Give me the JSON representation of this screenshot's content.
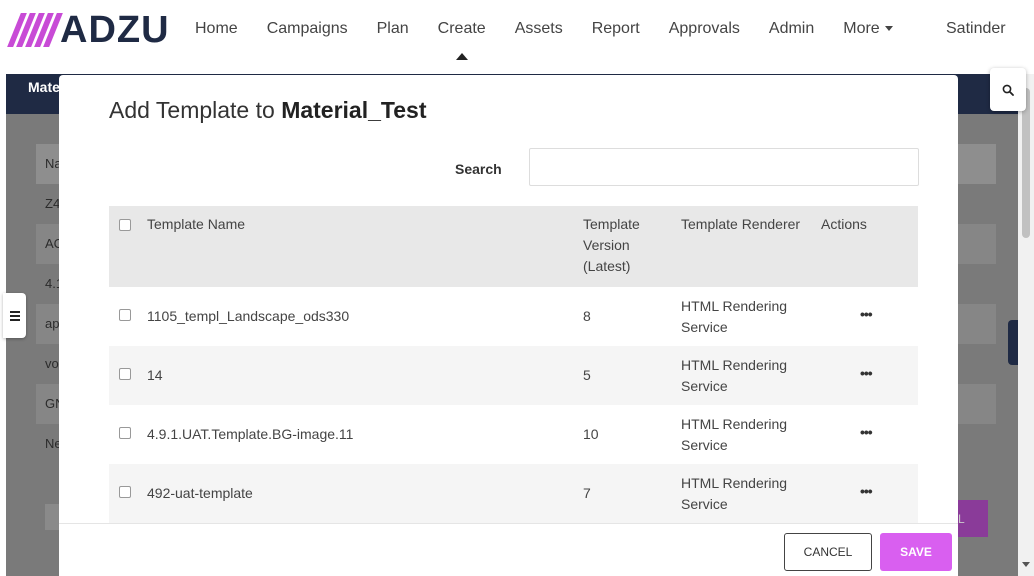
{
  "nav": {
    "brand": "ADZU",
    "items": [
      "Home",
      "Campaigns",
      "Plan",
      "Create",
      "Assets",
      "Report",
      "Approvals",
      "Admin"
    ],
    "more_label": "More",
    "active_item": "Create",
    "user": "Satinder"
  },
  "background": {
    "header_text": "Mate",
    "rows": [
      "Na",
      "Z4",
      "AC",
      "4.1",
      "ap",
      "vo",
      "GN",
      "Ne"
    ],
    "button_fragment": "L"
  },
  "modal": {
    "title_prefix": "Add Template to",
    "title_target": "Material_Test",
    "search_label": "Search",
    "search_value": "",
    "columns": {
      "name": "Template Name",
      "version": "Template Version (Latest)",
      "renderer": "Template Renderer",
      "actions": "Actions"
    },
    "rows": [
      {
        "name": "1105_templ_Landscape_ods330",
        "version": "8",
        "renderer": "HTML Rendering Service",
        "actions": "•••"
      },
      {
        "name": "14",
        "version": "5",
        "renderer": "HTML Rendering Service",
        "actions": "•••"
      },
      {
        "name": "4.9.1.UAT.Template.BG-image.11",
        "version": "10",
        "renderer": "HTML Rendering Service",
        "actions": "•••"
      },
      {
        "name": "492-uat-template",
        "version": "7",
        "renderer": "HTML Rendering Service",
        "actions": "•••"
      }
    ],
    "cancel_label": "CANCEL",
    "save_label": "SAVE"
  },
  "colors": {
    "brand_navy": "#1f2a44",
    "accent_magenta": "#d95ff0",
    "logo_slash": "#c84bd6"
  },
  "icons": {
    "menu": "hamburger-icon",
    "search": "search-icon",
    "more_caret": "chevron-down-icon",
    "actions": "ellipsis-icon"
  }
}
